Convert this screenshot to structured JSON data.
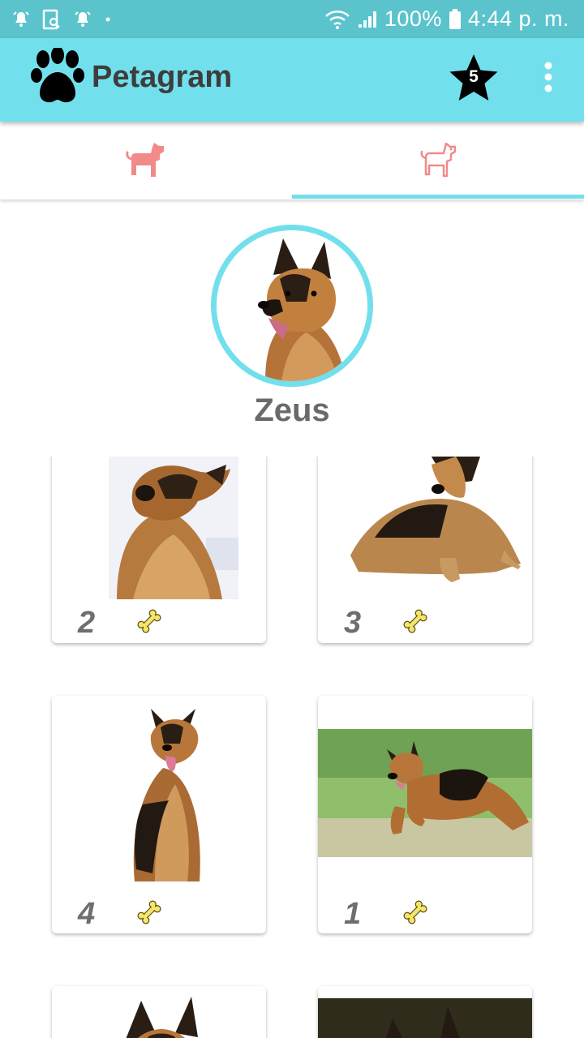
{
  "status_bar": {
    "battery": "100%",
    "time": "4:44 p. m."
  },
  "app_bar": {
    "title": "Petagram",
    "favorites_count": "5"
  },
  "tabs": [
    {
      "name": "home",
      "selected": false,
      "icon": "dog-filled-icon"
    },
    {
      "name": "profile",
      "selected": true,
      "icon": "dog-outline-icon"
    }
  ],
  "profile": {
    "name": "Zeus"
  },
  "pets": [
    {
      "rating": "2",
      "photo": "german-shepherd-sitting-head-tilt"
    },
    {
      "rating": "3",
      "photo": "german-shepherd-lying-down"
    },
    {
      "rating": "4",
      "photo": "german-shepherd-sitting-front"
    },
    {
      "rating": "1",
      "photo": "german-shepherd-running-grass"
    },
    {
      "rating": "",
      "photo": "german-shepherd-head"
    },
    {
      "rating": "",
      "photo": "german-shepherd-dark-background"
    }
  ],
  "colors": {
    "status_bar": "#5bc3cc",
    "app_bar": "#72e0ec",
    "accent": "#72e0ec",
    "tab_icon": "#f18a8a",
    "bone": "#f5e66a"
  }
}
